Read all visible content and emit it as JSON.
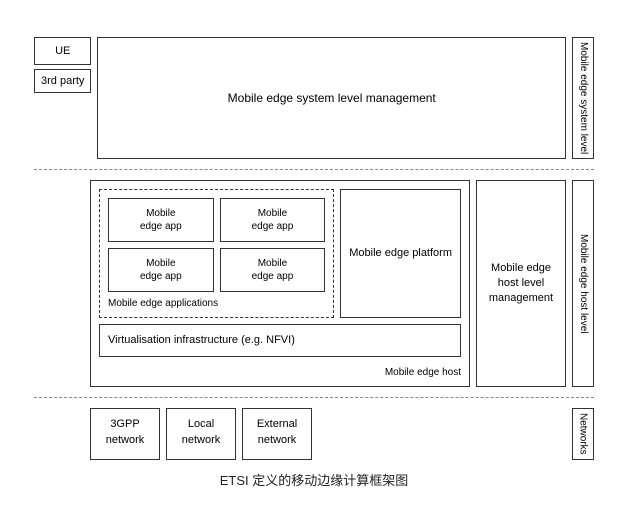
{
  "diagram": {
    "title": "ETSI 定义的移动边缘计算框架图",
    "ue_label": "UE",
    "party_label": "3rd party",
    "system_mgmt_label": "Mobile edge system level management",
    "side_system_label": "Mobile edge system level",
    "apps": [
      {
        "label": "Mobile\nedge app"
      },
      {
        "label": "Mobile\nedge app"
      },
      {
        "label": "Mobile\nedge app"
      },
      {
        "label": "Mobile\nedge app"
      }
    ],
    "apps_section_label": "Mobile edge applications",
    "platform_label": "Mobile edge platform",
    "virt_label": "Virtualisation infrastructure (e.g. NFVI)",
    "host_inner_label": "Mobile edge host",
    "host_mgmt_label": "Mobile edge host level management",
    "side_host_label": "Mobile edge host level",
    "networks": [
      {
        "label": "3GPP\nnetwork"
      },
      {
        "label": "Local\nnetwork"
      },
      {
        "label": "External\nnetwork"
      }
    ],
    "side_networks_label": "Networks"
  }
}
